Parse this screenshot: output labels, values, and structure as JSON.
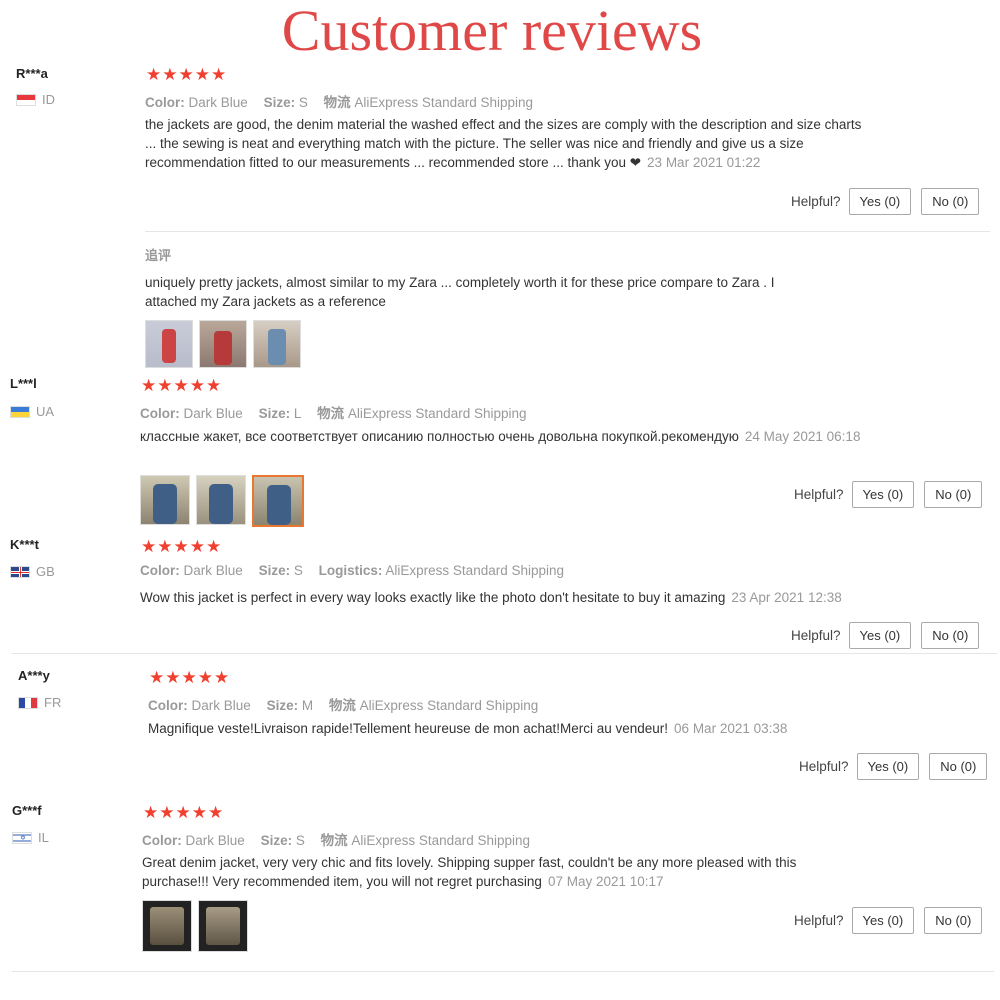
{
  "title": "Customer reviews",
  "labels": {
    "color": "Color:",
    "size": "Size:",
    "logistics_cn": "物流",
    "logistics_en": "Logistics:",
    "helpful": "Helpful?",
    "yes": "Yes (0)",
    "no": "No (0)",
    "stars": "★★★★★",
    "additional": "追评"
  },
  "reviews": [
    {
      "user": "R***a",
      "country": "ID",
      "color": "Dark Blue",
      "size": "S",
      "shipping": "AliExpress Standard Shipping",
      "text": "the jackets are good, the denim material the washed effect and the sizes are comply with the description and size charts ... the sewing is neat and everything match with the picture. The seller was nice and friendly and give us a size recommendation fitted to our measurements ... recommended store ... thank you ❤",
      "date": "23 Mar 2021 01:22",
      "followup": "uniquely pretty jackets, almost similar to my Zara ... completely worth it for these price compare to Zara . I attached my Zara jackets as a reference"
    },
    {
      "user": "L***l",
      "country": "UA",
      "color": "Dark Blue",
      "size": "L",
      "shipping": "AliExpress Standard Shipping",
      "text": "классные жакет, все соответствует описанию полностью очень довольна покупкой.рекомендую",
      "date": "24 May 2021 06:18"
    },
    {
      "user": "K***t",
      "country": "GB",
      "color": "Dark Blue",
      "size": "S",
      "shipping": "AliExpress Standard Shipping",
      "text": "Wow this jacket is perfect in every way looks exactly like the photo don't hesitate to buy it amazing",
      "date": "23 Apr 2021 12:38"
    },
    {
      "user": "A***y",
      "country": "FR",
      "color": "Dark Blue",
      "size": "M",
      "shipping": "AliExpress Standard Shipping",
      "text": "Magnifique veste!Livraison rapide!Tellement heureuse de mon achat!Merci au vendeur!",
      "date": "06 Mar 2021 03:38"
    },
    {
      "user": "G***f",
      "country": "IL",
      "color": "Dark Blue",
      "size": "S",
      "shipping": "AliExpress Standard Shipping",
      "text": "Great denim jacket, very very chic and fits lovely. Shipping supper fast, couldn't be any more pleased with this purchase!!! Very recommended item, you will not regret purchasing",
      "date": "07 May 2021 10:17"
    }
  ]
}
